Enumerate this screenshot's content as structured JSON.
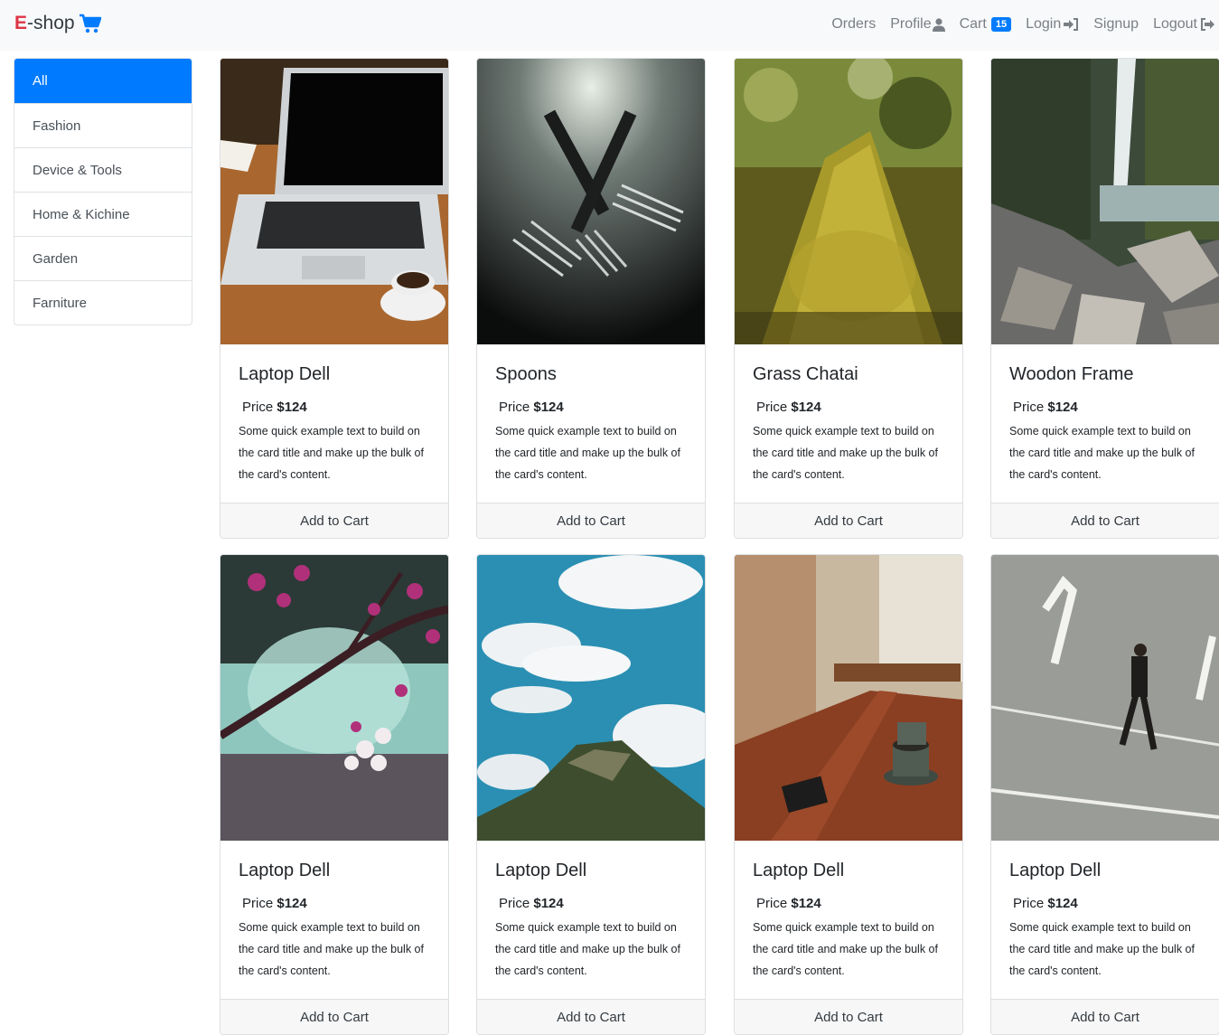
{
  "brand": {
    "prefix": "E",
    "suffix": "-shop",
    "icon": "shopping-cart-icon"
  },
  "nav": {
    "orders": "Orders",
    "profile": "Profile",
    "cart": "Cart",
    "cart_count": "15",
    "login": "Login",
    "signup": "Signup",
    "logout": "Logout"
  },
  "sidebar": {
    "items": [
      {
        "label": "All",
        "active": true
      },
      {
        "label": "Fashion"
      },
      {
        "label": "Device & Tools"
      },
      {
        "label": "Home & Kichine"
      },
      {
        "label": "Garden"
      },
      {
        "label": "Farniture"
      }
    ]
  },
  "products": [
    {
      "title": "Laptop Dell",
      "price_label": "Price",
      "price": "$124",
      "text": "Some quick example text to build on the card title and make up the bulk of the card's content.",
      "button": "Add to Cart",
      "image": "laptop-coffee"
    },
    {
      "title": "Spoons",
      "price_label": "Price",
      "price": "$124",
      "text": "Some quick example text to build on the card title and make up the bulk of the card's content.",
      "button": "Add to Cart",
      "image": "forks"
    },
    {
      "title": "Grass Chatai",
      "price_label": "Price",
      "price": "$124",
      "text": "Some quick example text to build on the card title and make up the bulk of the card's content.",
      "button": "Add to Cart",
      "image": "mossy-branch"
    },
    {
      "title": "Woodon Frame",
      "price_label": "Price",
      "price": "$124",
      "text": "Some quick example text to build on the card title and make up the bulk of the card's content.",
      "button": "Add to Cart",
      "image": "waterfall"
    },
    {
      "title": "Laptop Dell",
      "price_label": "Price",
      "price": "$124",
      "text": "Some quick example text to build on the card title and make up the bulk of the card's content.",
      "button": "Add to Cart",
      "image": "blossoms"
    },
    {
      "title": "Laptop Dell",
      "price_label": "Price",
      "price": "$124",
      "text": "Some quick example text to build on the card title and make up the bulk of the card's content.",
      "button": "Add to Cart",
      "image": "sky-mountain"
    },
    {
      "title": "Laptop Dell",
      "price_label": "Price",
      "price": "$124",
      "text": "Some quick example text to build on the card title and make up the bulk of the card's content.",
      "button": "Add to Cart",
      "image": "cafe-table"
    },
    {
      "title": "Laptop Dell",
      "price_label": "Price",
      "price": "$124",
      "text": "Some quick example text to build on the card title and make up the bulk of the card's content.",
      "button": "Add to Cart",
      "image": "man-walking"
    }
  ]
}
